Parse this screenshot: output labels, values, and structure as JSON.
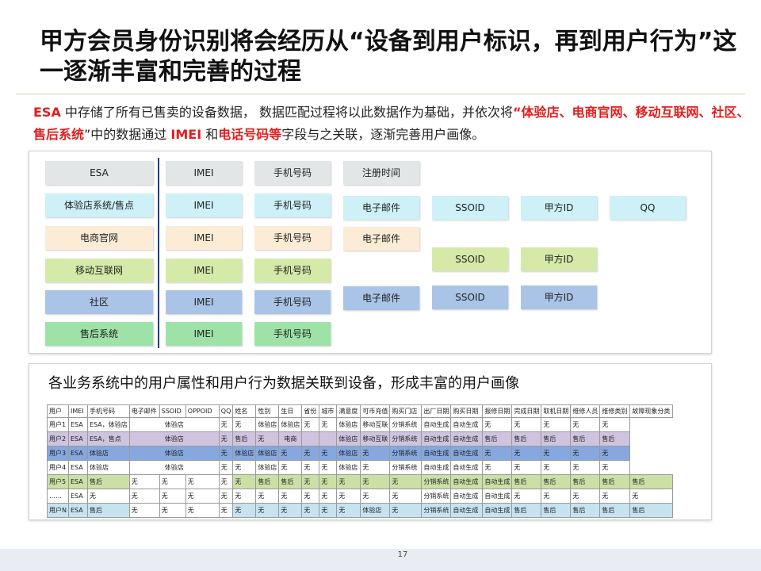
{
  "title": "甲方会员身份识别将会经历从“设备到用户标识，再到用户行为”这一逐渐丰富和完善的过程",
  "intro": {
    "p1": "ESA",
    "p2": " 中存储了所有已售卖的设备数据， 数据匹配过程将以此数据作为基础，并依次将",
    "p3": "“体验店、电商官网、移动互联网、社区、售后系统",
    "p4": "”中的数据通过 ",
    "p5": "IMEI",
    "p6": " 和",
    "p7": "电话号码等",
    "p8": "字段与之关联，逐渐完善用户画像。"
  },
  "diagram": {
    "sources": [
      "ESA",
      "体验店系统/售点",
      "电商官网",
      "移动互联网",
      "社区",
      "售后系统"
    ],
    "imei": "IMEI",
    "phone": "手机号码",
    "reg_time": "注册时间",
    "email": "电子邮件",
    "ssoid": "SSOID",
    "partyid": "甲方ID",
    "qq": "QQ"
  },
  "table": {
    "subtitle": "各业务系统中的用户属性和用户行为数据关联到设备，形成丰富的用户画像",
    "headers": [
      "用户",
      "IMEI",
      "手机号码",
      "电子邮件",
      "SSOID",
      "OPPOID",
      "QQ",
      "姓名",
      "性别",
      "生日",
      "省份",
      "城市",
      "满意度",
      "可币充值",
      "购买门店",
      "出厂日期",
      "购买日期",
      "报修日期",
      "完成日期",
      "取机日期",
      "维修人员",
      "维修类别",
      "故障现象分类"
    ],
    "rows": [
      {
        "user": "用户1",
        "imei": "ESA",
        "phone": "ESA，体验店",
        "merged": "体验店",
        "cells": [
          "无",
          "无",
          "体验店",
          "体验店",
          "无",
          "无",
          "体验店",
          "移动互联",
          "分销系统",
          "自动生成",
          "自动生成",
          "无",
          "无",
          "无",
          "无",
          "无"
        ]
      },
      {
        "user": "用户2",
        "imei": "ESA",
        "phone": "ESA，售点",
        "merged": "体验店",
        "cells": [
          "无",
          "售后",
          "无",
          "电商",
          "",
          "",
          "体验店",
          "移动互联",
          "分销系统",
          "自动生成",
          "自动生成",
          "售后",
          "售后",
          "售后",
          "售后",
          "售后"
        ]
      },
      {
        "user": "用户3",
        "imei": "ESA",
        "phone": "体验店",
        "merged": "体验店",
        "cells": [
          "无",
          "体验店",
          "体验店",
          "无",
          "无",
          "无",
          "体验店",
          "无",
          "分销系统",
          "自动生成",
          "自动生成",
          "无",
          "无",
          "无",
          "无",
          "无"
        ]
      },
      {
        "user": "用户4",
        "imei": "ESA",
        "phone": "体验店",
        "merged": "体验店",
        "cells": [
          "无",
          "无",
          "体验店",
          "无",
          "无",
          "无",
          "体验店",
          "无",
          "分销系统",
          "自动生成",
          "自动生成",
          "无",
          "无",
          "无",
          "无",
          "无"
        ]
      },
      {
        "user": "用户5",
        "imei": "ESA",
        "phone": "售后",
        "pre": [
          "无",
          "无",
          "无",
          "无"
        ],
        "cells": [
          "无",
          "售后",
          "售后",
          "无",
          "无",
          "无",
          "无",
          "无",
          "分销系统",
          "自动生成",
          "自动生成",
          "售后",
          "售后",
          "售后",
          "售后",
          "售后"
        ]
      },
      {
        "user": "……",
        "imei": "ESA",
        "phone": "无",
        "pre": [
          "无",
          "无",
          "无",
          "无"
        ],
        "cells": [
          "无",
          "无",
          "无",
          "无",
          "无",
          "无",
          "无",
          "无",
          "分销系统",
          "自动生成",
          "自动生成",
          "无",
          "无",
          "无",
          "无",
          "无"
        ]
      },
      {
        "user": "用户N",
        "imei": "ESA",
        "phone": "售后",
        "pre": [
          "无",
          "无",
          "无",
          "无"
        ],
        "cells": [
          "无",
          "无",
          "无",
          "无",
          "无",
          "无",
          "体验店",
          "无",
          "分销系统",
          "自动生成",
          "自动生成",
          "售后",
          "售后",
          "售后",
          "售后",
          "售后"
        ]
      }
    ]
  },
  "page_number": "17"
}
